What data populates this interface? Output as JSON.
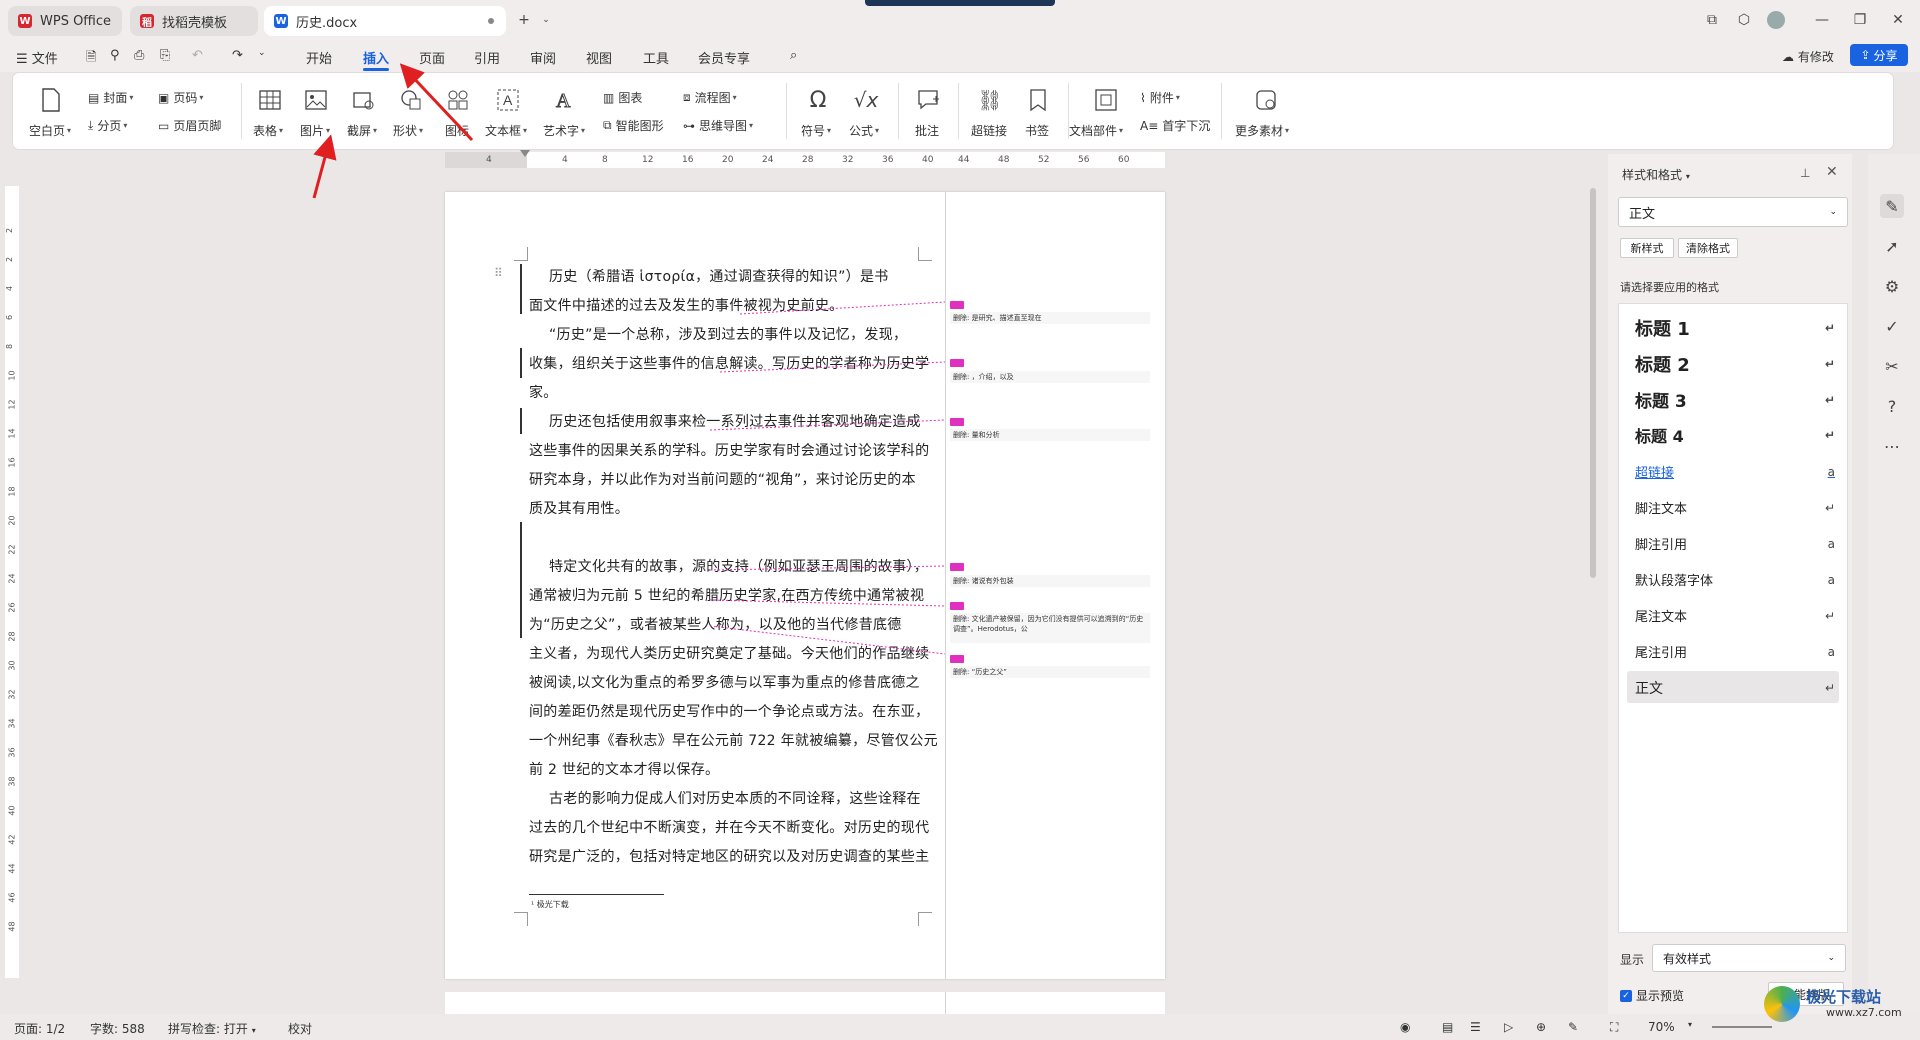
{
  "tabs": {
    "wps": "WPS Office",
    "template": "找稻壳模板",
    "doc": "历史.docx"
  },
  "menubar": {
    "file": "文件",
    "items": [
      "开始",
      "插入",
      "页面",
      "引用",
      "审阅",
      "视图",
      "工具",
      "会员专享"
    ],
    "modified": "有修改",
    "share": "分享"
  },
  "ribbon": {
    "blank_page": "空白页",
    "cover": "封面",
    "page_break": "分页",
    "page_num": "页码",
    "header_footer": "页眉页脚",
    "table": "表格",
    "picture": "图片",
    "screenshot": "截屏",
    "shape": "形状",
    "icon": "图标",
    "textbox": "文本框",
    "wordart": "艺术字",
    "chart": "图表",
    "smartart": "智能图形",
    "flowchart": "流程图",
    "mindmap": "思维导图",
    "symbol": "符号",
    "formula": "公式",
    "comment": "批注",
    "hyperlink": "超链接",
    "bookmark": "书签",
    "doc_parts": "文档部件",
    "attachment": "附件",
    "dropcap": "首字下沉",
    "more": "更多素材"
  },
  "ruler": [
    "4",
    "4",
    "8",
    "12",
    "16",
    "20",
    "24",
    "28",
    "32",
    "36",
    "40",
    "44",
    "48",
    "52",
    "56",
    "60"
  ],
  "vruler": [
    "2",
    "2",
    "4",
    "6",
    "8",
    "10",
    "12",
    "14",
    "16",
    "18",
    "20",
    "22",
    "24",
    "26",
    "28",
    "30",
    "32",
    "34",
    "36",
    "38",
    "40",
    "42",
    "44",
    "46",
    "48"
  ],
  "document": {
    "lines": [
      "历史（希腊语 ἱστορία，通过调查获得的知识”）是书",
      "面文件中描述的过去及发生的事件被视为史前史。",
      "“历史”是一个总称，涉及到过去的事件以及记忆，发现，",
      "收集，组织关于这些事件的信息解读。写历史的学者称为历史学",
      "家。",
      "历史还包括使用叙事来检一系列过去事件并客观地确定造成",
      "这些事件的因果关系的学科。历史学家有时会通过讨论该学科的",
      "研究本身，并以此作为对当前问题的“视角”，来讨论历史的本",
      "质及其有用性。",
      "特定文化共有的故事，源的支持（例如亚瑟王周围的故事），",
      "通常被归为元前 5 世纪的希腊历史学家,在西方传统中通常被视",
      "为“历史之父”，或者被某些人称为，以及他的当代修昔底德",
      "主义者，为现代人类历史研究奠定了基础。今天他们的作品继续",
      "被阅读,以文化为重点的希罗多德与以军事为重点的修昔底德之",
      "间的差距仍然是现代历史写作中的一个争论点或方法。在东亚，",
      "一个州纪事《春秋志》早在公元前 722 年就被编纂，尽管仅公元",
      "前 2 世纪的文本才得以保存。",
      "古老的影响力促成人们对历史本质的不同诠释，这些诠释在",
      "过去的几个世纪中不断演变，并在今天不断变化。对历史的现代",
      "研究是广泛的，包括对特定地区的研究以及对历史调查的某些主"
    ],
    "footnote": "¹ 极光下载"
  },
  "balloons": [
    "删除: 是研究、描述直至现在",
    "删除: ，介绍，以及",
    "删除: 量和分析",
    "删除: 诸说有外包装",
    "删除: 文化遗产被保留，因为它们没有提供可以追溯到的“历史调查”。Herodotus，公",
    "删除: “历史之父”"
  ],
  "panel": {
    "title": "样式和格式",
    "current_style": "正文",
    "new_style": "新样式",
    "clear_format": "清除格式",
    "choose_label": "请选择要应用的格式",
    "styles": [
      "标题  1",
      "标题  2",
      "标题  3",
      "标题  4",
      "超链接",
      "脚注文本",
      "脚注引用",
      "默认段落字体",
      "尾注文本",
      "尾注引用",
      "正文"
    ],
    "show_label": "显示",
    "show_value": "有效样式",
    "preview": "显示预览",
    "smart": "智能排版"
  },
  "status": {
    "page": "页面: 1/2",
    "words": "字数: 588",
    "spell": "拼写检查: 打开",
    "proof": "校对",
    "zoom": "70%"
  },
  "watermark": {
    "site": "极光下载站",
    "url": "www.xz7.com"
  },
  "colors": {
    "accent": "#1a63e0",
    "brand_red": "#d8262f",
    "markup": "#e030c0",
    "arrow": "#e02020"
  }
}
